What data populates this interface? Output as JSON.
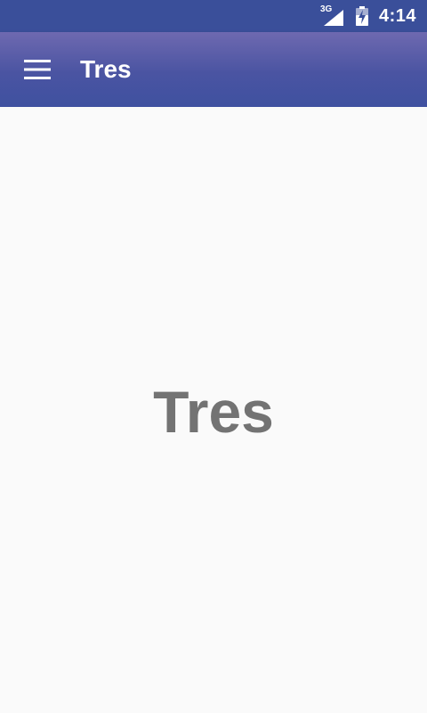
{
  "status_bar": {
    "network_type": "3G",
    "time": "4:14",
    "signal_icon": "cell-signal-icon",
    "battery_icon": "battery-charging-icon"
  },
  "app_bar": {
    "title": "Tres",
    "menu_icon": "hamburger-menu-icon",
    "color": "#3f51a0"
  },
  "content": {
    "label": "Tres"
  }
}
